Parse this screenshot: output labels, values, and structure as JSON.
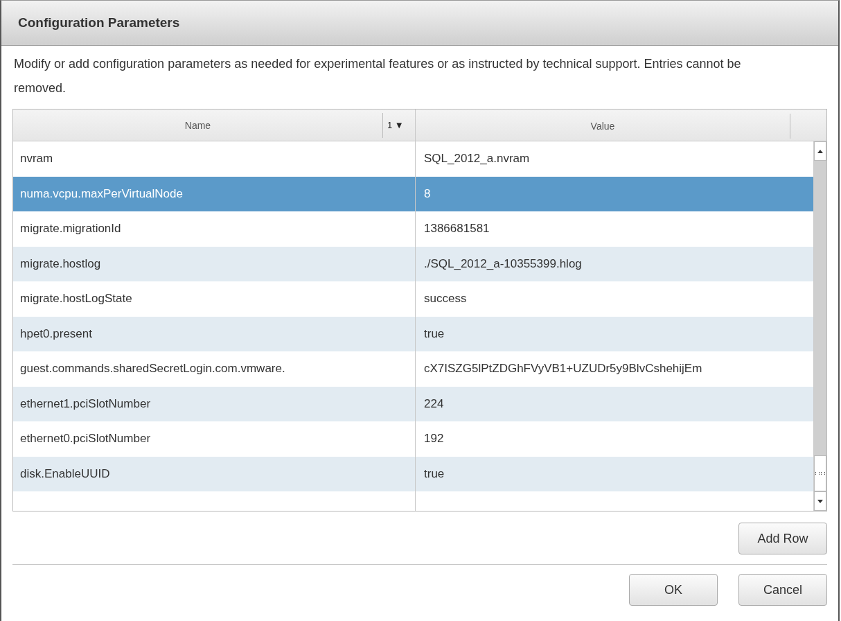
{
  "dialog": {
    "title": "Configuration Parameters",
    "description": "Modify or add configuration parameters as needed for experimental features or as instructed by technical support. Entries cannot be removed."
  },
  "table": {
    "columns": [
      {
        "label": "Name",
        "sort_order": "1",
        "sort_arrow": "▼"
      },
      {
        "label": "Value"
      }
    ],
    "rows": [
      {
        "name": "nvram",
        "value": "SQL_2012_a.nvram",
        "selected": false
      },
      {
        "name": "numa.vcpu.maxPerVirtualNode",
        "value": "8",
        "selected": true
      },
      {
        "name": "migrate.migrationId",
        "value": "1386681581",
        "selected": false
      },
      {
        "name": "migrate.hostlog",
        "value": "./SQL_2012_a-10355399.hlog",
        "selected": false
      },
      {
        "name": "migrate.hostLogState",
        "value": "success",
        "selected": false
      },
      {
        "name": "hpet0.present",
        "value": "true",
        "selected": false
      },
      {
        "name": "guest.commands.sharedSecretLogin.com.vmware.",
        "value": "cX7ISZG5lPtZDGhFVyVB1+UZUDr5y9BlvCshehijEm",
        "selected": false
      },
      {
        "name": "ethernet1.pciSlotNumber",
        "value": "224",
        "selected": false
      },
      {
        "name": "ethernet0.pciSlotNumber",
        "value": "192",
        "selected": false
      },
      {
        "name": "disk.EnableUUID",
        "value": "true",
        "selected": false
      }
    ]
  },
  "add_row_button": "Add Row",
  "buttons": [
    "OK",
    "Cancel"
  ]
}
